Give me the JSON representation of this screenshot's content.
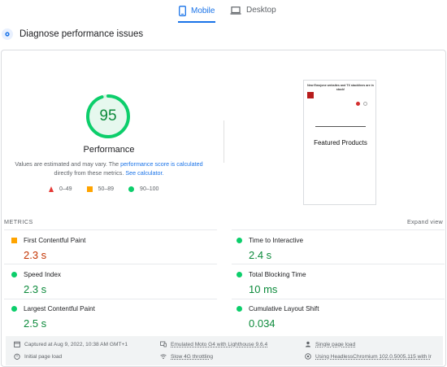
{
  "tabs": {
    "mobile_label": "Mobile",
    "desktop_label": "Desktop",
    "active": "Mobile",
    "accent": "#1a73e8"
  },
  "diagnose": {
    "title": "Diagnose performance issues"
  },
  "performance": {
    "score": 95,
    "score_display": "95",
    "score_fraction": 0.95,
    "label": "Performance",
    "note_part1": "Values are estimated and may vary. The ",
    "note_link1": "performance score is calculated",
    "note_part2": " directly from these metrics. ",
    "note_link2": "See calculator.",
    "colors": {
      "good": "#0cce6b",
      "average": "#ffa400",
      "poor": "#e53935"
    }
  },
  "legend": {
    "poor": "0–49",
    "average": "50–89",
    "good": "90–100"
  },
  "preview": {
    "headline": "New Emojone websites and TX stacklines are in stock!",
    "featured": "Featured Products"
  },
  "metrics": {
    "heading": "METRICS",
    "expand": "Expand view",
    "items": [
      {
        "label": "First Contentful Paint",
        "value": "2.3 s",
        "status": "average"
      },
      {
        "label": "Time to Interactive",
        "value": "2.4 s",
        "status": "good"
      },
      {
        "label": "Speed Index",
        "value": "2.3 s",
        "status": "good"
      },
      {
        "label": "Total Blocking Time",
        "value": "10 ms",
        "status": "good"
      },
      {
        "label": "Largest Contentful Paint",
        "value": "2.5 s",
        "status": "good"
      },
      {
        "label": "Cumulative Layout Shift",
        "value": "0.034",
        "status": "good"
      }
    ]
  },
  "footer": {
    "captured": "Captured at Aug 9, 2022, 10:38 AM GMT+1",
    "emulated": "Emulated Moto G4 with Lighthouse 9.6.4",
    "single_page": "Single page load",
    "initial": "Initial page load",
    "throttling": "Slow 4G throttling",
    "browser": "Using HeadlessChromium 102.0.5005.115 with lr"
  }
}
